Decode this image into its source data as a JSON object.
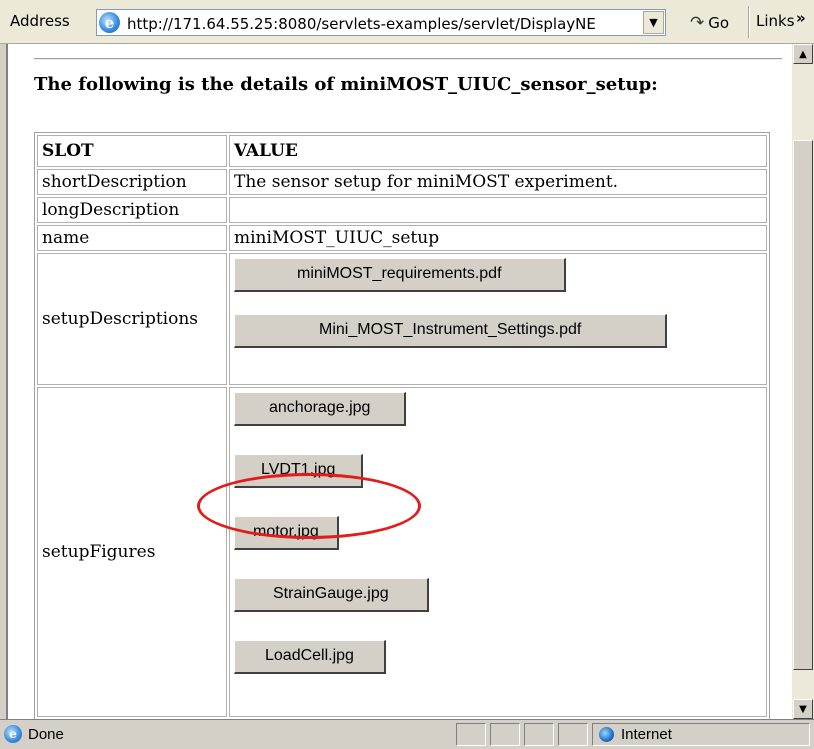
{
  "address_bar": {
    "label": "Address",
    "url": "http://171.64.55.25:8080/servlets-examples/servlet/DisplayNE",
    "go_label": "Go",
    "links_label": "Links",
    "links_chevron": "»"
  },
  "page": {
    "heading": "The following is the details of miniMOST_UIUC_sensor_setup:",
    "table": {
      "headers": {
        "slot": "SLOT",
        "value": "VALUE"
      },
      "rows": {
        "shortDescription": {
          "slot": "shortDescription",
          "value": "The sensor setup for miniMOST experiment."
        },
        "longDescription": {
          "slot": "longDescription",
          "value": ""
        },
        "name": {
          "slot": "name",
          "value": "miniMOST_UIUC_setup"
        },
        "setupDescriptions": {
          "slot": "setupDescriptions",
          "buttons": [
            "miniMOST_requirements.pdf",
            "Mini_MOST_Instrument_Settings.pdf"
          ]
        },
        "setupFigures": {
          "slot": "setupFigures",
          "buttons": [
            "anchorage.jpg",
            "LVDT1.jpg",
            "motor.jpg",
            "StrainGauge.jpg",
            "LoadCell.jpg"
          ]
        }
      }
    },
    "highlight_color": "#e21b1b"
  },
  "status_bar": {
    "text": "Done",
    "zone": "Internet"
  }
}
